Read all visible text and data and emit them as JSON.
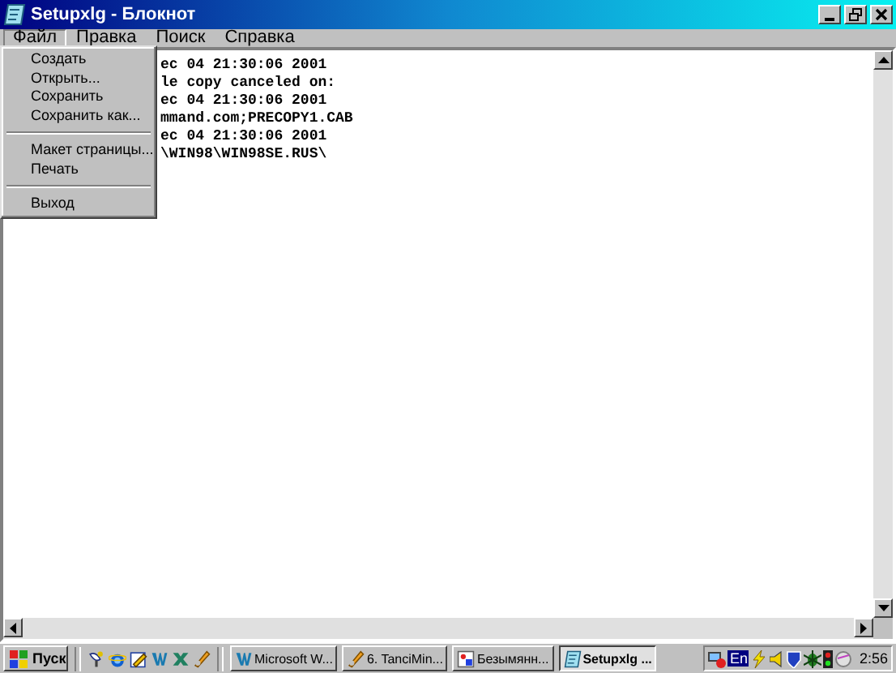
{
  "window": {
    "title": "Setupxlg - Блокнот"
  },
  "menu_bar": [
    {
      "label": "Файл",
      "selected": true
    },
    {
      "label": "Правка",
      "selected": false
    },
    {
      "label": "Поиск",
      "selected": false
    },
    {
      "label": "Справка",
      "selected": false
    }
  ],
  "file_menu": [
    {
      "kind": "item",
      "label": "Создать"
    },
    {
      "kind": "item",
      "label": "Открыть..."
    },
    {
      "kind": "item",
      "label": "Сохранить"
    },
    {
      "kind": "item",
      "label": "Сохранить как..."
    },
    {
      "kind": "separator"
    },
    {
      "kind": "item",
      "label": "Макет страницы..."
    },
    {
      "kind": "item",
      "label": "Печать"
    },
    {
      "kind": "separator"
    },
    {
      "kind": "item",
      "label": "Выход"
    }
  ],
  "text_lines": [
    "ec 04 21:30:06 2001",
    "le copy canceled on:",
    "ec 04 21:30:06 2001",
    "mmand.com;PRECOPY1.CAB",
    "ec 04 21:30:06 2001",
    "\\WIN98\\WIN98SE.RUS\\"
  ],
  "taskbar": {
    "start": "Пуск",
    "quick_launch": [
      {
        "kind": "desktop"
      },
      {
        "kind": "browser"
      },
      {
        "kind": "pencil"
      },
      {
        "kind": "word"
      },
      {
        "kind": "excel"
      },
      {
        "kind": "tool"
      }
    ],
    "tasks": [
      {
        "label": "Microsoft W...",
        "kind": "word",
        "selected": false
      },
      {
        "label": "6. TanciMin...",
        "kind": "tool",
        "selected": false
      },
      {
        "label": "Безымянн...",
        "kind": "paint",
        "selected": false
      },
      {
        "label": "Setupxlg ...",
        "kind": "notepad",
        "selected": true
      }
    ],
    "language": "En",
    "clock": "2:56"
  }
}
